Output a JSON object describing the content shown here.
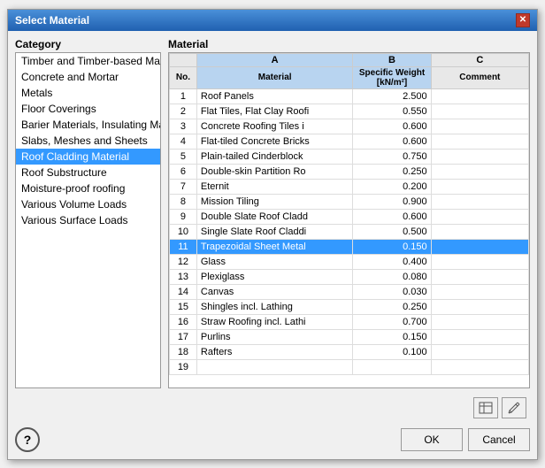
{
  "dialog": {
    "title": "Select Material",
    "close_label": "✕"
  },
  "category": {
    "label": "Category",
    "items": [
      {
        "id": 1,
        "text": "Timber and Timber-based Mater",
        "selected": false
      },
      {
        "id": 2,
        "text": "Concrete and Mortar",
        "selected": false
      },
      {
        "id": 3,
        "text": "Metals",
        "selected": false
      },
      {
        "id": 4,
        "text": "Floor Coverings",
        "selected": false
      },
      {
        "id": 5,
        "text": "Barier Materials, Insulating Mate",
        "selected": false
      },
      {
        "id": 6,
        "text": "Slabs, Meshes and Sheets",
        "selected": false
      },
      {
        "id": 7,
        "text": "Roof Cladding Material",
        "selected": true
      },
      {
        "id": 8,
        "text": "Roof Substructure",
        "selected": false
      },
      {
        "id": 9,
        "text": "Moisture-proof roofing",
        "selected": false
      },
      {
        "id": 10,
        "text": "Various Volume Loads",
        "selected": false
      },
      {
        "id": 11,
        "text": "Various Surface Loads",
        "selected": false
      }
    ]
  },
  "material": {
    "label": "Material",
    "col_a": "A",
    "col_b": "B",
    "col_c": "C",
    "col_no_header": "No.",
    "col_material_header": "Material",
    "col_weight_header": "Specific Weight",
    "col_weight_unit": "[kN/m²]",
    "col_comment_header": "Comment",
    "rows": [
      {
        "no": 1,
        "material": "Roof Panels",
        "weight": "2.500",
        "comment": "",
        "selected": false
      },
      {
        "no": 2,
        "material": "Flat Tiles, Flat Clay Roofi",
        "weight": "0.550",
        "comment": "",
        "selected": false
      },
      {
        "no": 3,
        "material": "Concrete Roofing Tiles i",
        "weight": "0.600",
        "comment": "",
        "selected": false
      },
      {
        "no": 4,
        "material": "Flat-tiled Concrete Bricks",
        "weight": "0.600",
        "comment": "",
        "selected": false
      },
      {
        "no": 5,
        "material": "Plain-tailed Cinderblock",
        "weight": "0.750",
        "comment": "",
        "selected": false
      },
      {
        "no": 6,
        "material": "Double-skin Partition Ro",
        "weight": "0.250",
        "comment": "",
        "selected": false
      },
      {
        "no": 7,
        "material": "Eternit",
        "weight": "0.200",
        "comment": "",
        "selected": false
      },
      {
        "no": 8,
        "material": "Mission Tiling",
        "weight": "0.900",
        "comment": "",
        "selected": false
      },
      {
        "no": 9,
        "material": "Double Slate Roof Cladd",
        "weight": "0.600",
        "comment": "",
        "selected": false
      },
      {
        "no": 10,
        "material": "Single Slate Roof Claddi",
        "weight": "0.500",
        "comment": "",
        "selected": false
      },
      {
        "no": 11,
        "material": "Trapezoidal Sheet Metal",
        "weight": "0.150",
        "comment": "",
        "selected": true
      },
      {
        "no": 12,
        "material": "Glass",
        "weight": "0.400",
        "comment": "",
        "selected": false
      },
      {
        "no": 13,
        "material": "Plexiglass",
        "weight": "0.080",
        "comment": "",
        "selected": false
      },
      {
        "no": 14,
        "material": "Canvas",
        "weight": "0.030",
        "comment": "",
        "selected": false
      },
      {
        "no": 15,
        "material": "Shingles incl. Lathing",
        "weight": "0.250",
        "comment": "",
        "selected": false
      },
      {
        "no": 16,
        "material": "Straw Roofing incl. Lathi",
        "weight": "0.700",
        "comment": "",
        "selected": false
      },
      {
        "no": 17,
        "material": "Purlins",
        "weight": "0.150",
        "comment": "",
        "selected": false
      },
      {
        "no": 18,
        "material": "Rafters",
        "weight": "0.100",
        "comment": "",
        "selected": false
      },
      {
        "no": 19,
        "material": "",
        "weight": "",
        "comment": "",
        "selected": false
      }
    ]
  },
  "buttons": {
    "ok": "OK",
    "cancel": "Cancel",
    "help": "?",
    "icon1": "🖼",
    "icon2": "✏"
  }
}
